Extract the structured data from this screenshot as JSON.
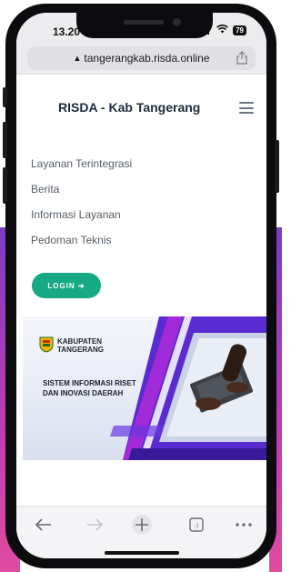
{
  "status": {
    "time": "13.20",
    "battery": "79"
  },
  "browser": {
    "url": "tangerangkab.risda.online"
  },
  "site": {
    "title": "RISDA - Kab Tangerang"
  },
  "nav": [
    {
      "label": "Layanan Terintegrasi"
    },
    {
      "label": "Berita"
    },
    {
      "label": "Informasi Layanan"
    },
    {
      "label": "Pedoman Teknis"
    }
  ],
  "login": {
    "label": "LOGIN ➔"
  },
  "banner": {
    "kab_line1": "KABUPATEN",
    "kab_line2": "TANGERANG",
    "title_line1": "SISTEM INFORMASI RISET",
    "title_line2": "DAN INOVASI DAERAH"
  },
  "toolbar": {
    "icons": [
      "back-arrow-icon",
      "forward-arrow-icon",
      "plus-icon",
      "tabs-icon",
      "more-icon"
    ]
  },
  "colors": {
    "accent": "#17a983",
    "title": "#1f2d3d",
    "banner_purple": "#5a2bd0"
  }
}
